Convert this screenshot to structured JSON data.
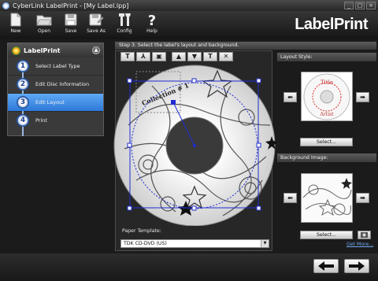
{
  "window": {
    "title": "CyberLink LabelPrint - [My Label.lpp]",
    "controls": [
      "_",
      "□",
      "×"
    ]
  },
  "toolbar": {
    "buttons": [
      {
        "label": "New",
        "icon": "new-document-icon"
      },
      {
        "label": "Open",
        "icon": "open-folder-icon"
      },
      {
        "label": "Save",
        "icon": "save-icon"
      },
      {
        "label": "Save As",
        "icon": "save-as-icon"
      },
      {
        "label": "Config",
        "icon": "tools-icon"
      },
      {
        "label": "Help",
        "icon": "help-icon"
      }
    ],
    "brand": "LabelPrint"
  },
  "sidebar": {
    "title": "LabelPrint",
    "steps": [
      {
        "number": "1",
        "label": "Select Label Type"
      },
      {
        "number": "2",
        "label": "Edit Disc Information"
      },
      {
        "number": "3",
        "label": "Edit Layout",
        "active": true
      },
      {
        "number": "4",
        "label": "Print"
      }
    ]
  },
  "workspace": {
    "instruction": "Step 3. Select the label's layout and background.",
    "layout_tools": [
      "T",
      "⅄",
      "▣",
      "▲",
      "▼",
      "T",
      "✕"
    ],
    "disc_text": "Collection # 1",
    "paper_template_label": "Paper Template:",
    "paper_template_value": "TDK CD-DVD (US)"
  },
  "layout_style": {
    "header": "Layout Style:",
    "preview_title": "Title",
    "preview_artist": "Artist",
    "select_label": "Select..."
  },
  "background_image": {
    "header": "Background Image:",
    "select_label": "Select...",
    "get_more_label": "Get More..."
  },
  "colors": {
    "active_step": "#3b8ee8",
    "selection_handle": "#1f2cd0"
  }
}
